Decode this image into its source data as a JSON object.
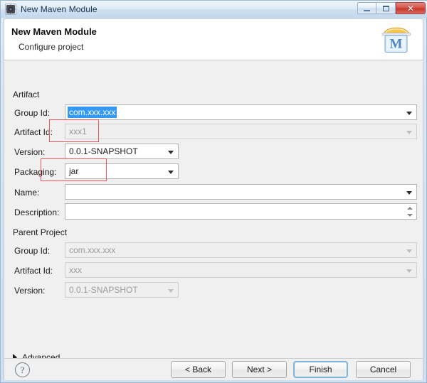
{
  "window": {
    "title": "New Maven Module",
    "icon": "maven-module-icon",
    "controls": {
      "minimize": "minimize",
      "restore": "restore",
      "close": "close"
    }
  },
  "header": {
    "heading": "New Maven Module",
    "subheading": "Configure project",
    "icon": "maven-logo-icon"
  },
  "artifact": {
    "group_title": "Artifact",
    "group_id": {
      "label": "Group Id:",
      "value": "com.xxx.xxx",
      "selected": true,
      "has_dropdown": true,
      "enabled": true
    },
    "artifact_id": {
      "label": "Artifact Id:",
      "value": "xxx1",
      "has_dropdown": true,
      "enabled": false,
      "annotated": true
    },
    "version": {
      "label": "Version:",
      "value": "0.0.1-SNAPSHOT",
      "has_dropdown": true,
      "enabled": true
    },
    "packaging": {
      "label": "Packaging:",
      "value": "jar",
      "has_dropdown": true,
      "enabled": true,
      "annotated": true
    },
    "name": {
      "label": "Name:",
      "value": "",
      "has_dropdown": true,
      "enabled": true
    },
    "description": {
      "label": "Description:",
      "value": "",
      "has_spinner": true,
      "enabled": true
    }
  },
  "parent_project": {
    "group_title": "Parent Project",
    "group_id": {
      "label": "Group Id:",
      "value": "com.xxx.xxx",
      "has_dropdown": true,
      "enabled": false
    },
    "artifact_id": {
      "label": "Artifact Id:",
      "value": "xxx",
      "has_dropdown": true,
      "enabled": false
    },
    "version": {
      "label": "Version:",
      "value": "0.0.1-SNAPSHOT",
      "has_dropdown": true,
      "enabled": false
    }
  },
  "advanced": {
    "label": "Advanced",
    "expanded": false
  },
  "footer": {
    "help": "?",
    "back": "< Back",
    "next": "Next >",
    "finish": "Finish",
    "cancel": "Cancel",
    "default_button": "Finish"
  },
  "colors": {
    "selection": "#3399f2",
    "annotation": "#e8575b",
    "title_bar": "#dfeaf5",
    "close_button": "#d9534a",
    "focus_ring": "#78b6e0"
  }
}
